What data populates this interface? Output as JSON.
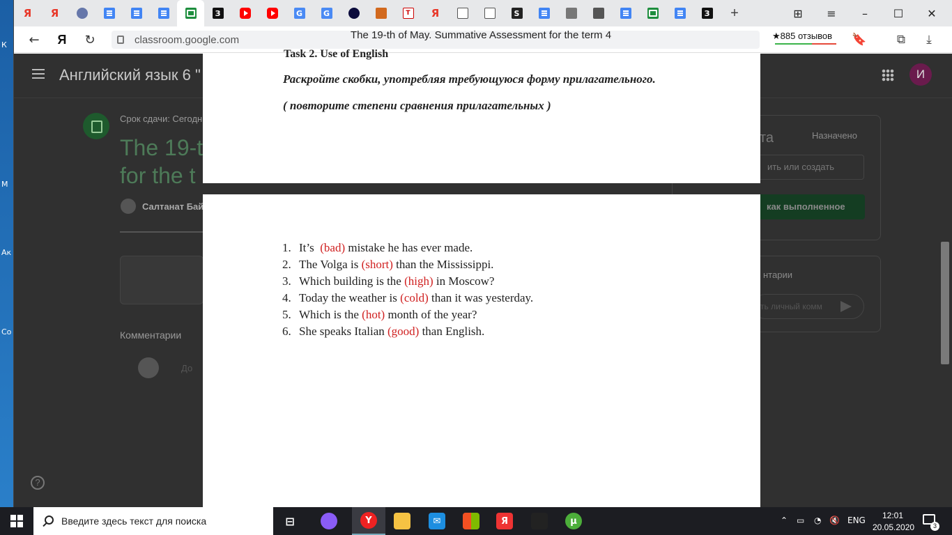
{
  "browser": {
    "tabs": [
      {
        "icon": "yandex-icon",
        "type": "yandex",
        "glyph": "Я"
      },
      {
        "icon": "yandex-icon",
        "type": "yandex",
        "glyph": "Я"
      },
      {
        "icon": "game-icon",
        "type": "game",
        "glyph": ""
      },
      {
        "icon": "google-docs-icon",
        "type": "docs",
        "glyph": ""
      },
      {
        "icon": "contacts-icon",
        "type": "docs",
        "glyph": ""
      },
      {
        "icon": "google-docs-icon",
        "type": "docs",
        "glyph": ""
      },
      {
        "icon": "google-classroom-icon",
        "type": "classroom",
        "glyph": "",
        "active": true
      },
      {
        "icon": "z-icon",
        "type": "z",
        "glyph": "З"
      },
      {
        "icon": "youtube-icon",
        "type": "youtube",
        "glyph": ""
      },
      {
        "icon": "youtube-icon",
        "type": "youtube",
        "glyph": ""
      },
      {
        "icon": "google-translate-icon",
        "type": "translate",
        "glyph": "G"
      },
      {
        "icon": "google-translate-icon",
        "type": "translate",
        "glyph": "G"
      },
      {
        "icon": "planet-icon",
        "type": "dark",
        "glyph": ""
      },
      {
        "icon": "site-icon",
        "type": "misc",
        "glyph": ""
      },
      {
        "icon": "site-icon",
        "type": "red",
        "glyph": "Т"
      },
      {
        "icon": "yandex-icon",
        "type": "yandex",
        "glyph": "Я"
      },
      {
        "icon": "document-icon",
        "type": "file",
        "glyph": ""
      },
      {
        "icon": "document-icon",
        "type": "file",
        "glyph": ""
      },
      {
        "icon": "s-icon",
        "type": "s",
        "glyph": "S"
      },
      {
        "icon": "google-docs-icon",
        "type": "docs",
        "glyph": ""
      },
      {
        "icon": "site-icon",
        "type": "gray",
        "glyph": ""
      },
      {
        "icon": "photo-icon",
        "type": "photo",
        "glyph": ""
      },
      {
        "icon": "google-docs-icon",
        "type": "docs",
        "glyph": ""
      },
      {
        "icon": "google-sheets-icon",
        "type": "classroom",
        "glyph": ""
      },
      {
        "icon": "google-docs-icon",
        "type": "docs",
        "glyph": ""
      },
      {
        "icon": "z-icon",
        "type": "z",
        "glyph": "З"
      }
    ],
    "url": "classroom.google.com",
    "page_title": "The 19-th of May. Summative Assessment for the term 4",
    "reviews": "★885 отзывов"
  },
  "classroom": {
    "course_title": "Английский язык 6 \"",
    "avatar_letter": "И",
    "due": "Срок сдачи: Сегодн",
    "assignment_title": "The 19-t for the t",
    "author": "Салтанат Бай",
    "comments_label": "Комментарии",
    "comment_placeholder": "До",
    "right_title": "та",
    "status": "Назначено",
    "add_button": "ить или создать",
    "done_button": "как выполненное",
    "private_comments": "нтарии",
    "private_placeholder": "ть личный комм"
  },
  "document": {
    "task_heading": "Task 2. Use of English",
    "instruction": "Раскройте скобки, употребляя требующуюся форму прилагательного.",
    "instruction_note": "( повторите степени сравнения прилагательных )",
    "sentences": [
      {
        "num": "1.",
        "before": "It’s  ",
        "adj": "(bad)",
        "after": " mistake he has ever made."
      },
      {
        "num": "2.",
        "before": "The Volga is ",
        "adj": "(short)",
        "after": " than the Mississippi."
      },
      {
        "num": "3.",
        "before": "Which building is the ",
        "adj": "(high)",
        "after": " in Moscow?"
      },
      {
        "num": "4.",
        "before": "Today the weather is ",
        "adj": "(cold)",
        "after": " than it was yesterday."
      },
      {
        "num": "5.",
        "before": "Which is the ",
        "adj": "(hot)",
        "after": " month of the year?"
      },
      {
        "num": "6.",
        "before": "She speaks Italian ",
        "adj": "(good)",
        "after": " than English."
      }
    ]
  },
  "taskbar": {
    "search_placeholder": "Введите здесь текст для поиска",
    "language": "ENG",
    "time": "12:01",
    "date": "20.05.2020",
    "notifications": "3"
  },
  "desktop": {
    "labels": [
      "К",
      "М",
      "Ак",
      "Со"
    ]
  }
}
